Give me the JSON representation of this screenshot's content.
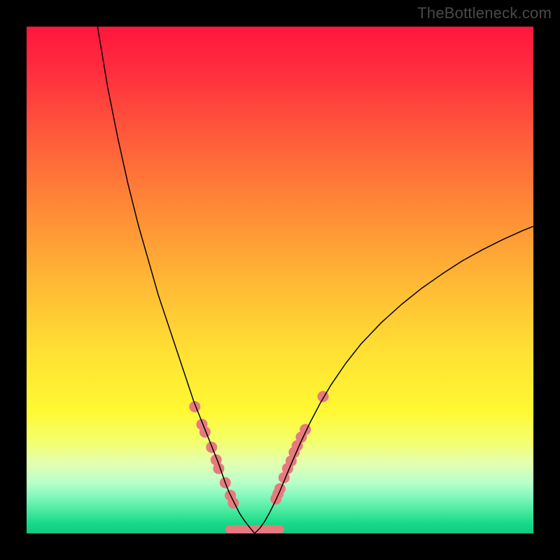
{
  "watermark": "TheBottleneck.com",
  "chart_data": {
    "type": "line",
    "title": "",
    "xlabel": "",
    "ylabel": "",
    "xlim": [
      0,
      100
    ],
    "ylim": [
      0,
      100
    ],
    "grid": false,
    "legend": false,
    "series": [
      {
        "name": "left-curve",
        "x": [
          14,
          16,
          18,
          20,
          22,
          24,
          26,
          28,
          30,
          32,
          33,
          34,
          35,
          36,
          37,
          37.8,
          38.5,
          39.2,
          40,
          41,
          42,
          43,
          44,
          45
        ],
        "y": [
          100,
          88,
          78,
          69,
          61,
          54,
          47,
          41,
          35,
          29,
          26,
          23.5,
          21,
          18.5,
          16,
          14,
          12,
          10,
          8,
          6,
          4,
          2.5,
          1.2,
          0
        ],
        "stroke": "#000000",
        "width": 1.5
      },
      {
        "name": "right-curve",
        "x": [
          45,
          46,
          47,
          48,
          49,
          50,
          51,
          52,
          54,
          56,
          58,
          60,
          63,
          66,
          70,
          74,
          78,
          82,
          86,
          90,
          94,
          98,
          100
        ],
        "y": [
          0,
          1,
          2.4,
          4.2,
          6.2,
          8.4,
          10.8,
          13.2,
          17.8,
          22,
          25.8,
          29.2,
          33.6,
          37.4,
          41.6,
          45.2,
          48.4,
          51.2,
          53.8,
          56,
          58,
          59.8,
          60.6
        ],
        "stroke": "#000000",
        "width": 1.5
      },
      {
        "name": "flat-bottom-segment",
        "x": [
          40,
          50
        ],
        "y": [
          0.8,
          0.8
        ],
        "stroke": "#e77a7e",
        "width": 12
      }
    ],
    "markers": {
      "name": "highlight-markers",
      "stroke": "none",
      "fill": "#e77a7e",
      "radius": 8,
      "points": [
        {
          "x": 33.2,
          "y": 25
        },
        {
          "x": 34.6,
          "y": 21.5
        },
        {
          "x": 35.2,
          "y": 20
        },
        {
          "x": 36.5,
          "y": 17
        },
        {
          "x": 37.4,
          "y": 14.5
        },
        {
          "x": 37.9,
          "y": 12.8
        },
        {
          "x": 39.2,
          "y": 10
        },
        {
          "x": 40.2,
          "y": 7.5
        },
        {
          "x": 40.8,
          "y": 6
        },
        {
          "x": 49.2,
          "y": 6.8
        },
        {
          "x": 49.6,
          "y": 7.8
        },
        {
          "x": 50.0,
          "y": 8.8
        },
        {
          "x": 50.8,
          "y": 11
        },
        {
          "x": 51.5,
          "y": 12.8
        },
        {
          "x": 52.2,
          "y": 14.3
        },
        {
          "x": 52.8,
          "y": 16
        },
        {
          "x": 53.4,
          "y": 17.3
        },
        {
          "x": 54.2,
          "y": 19
        },
        {
          "x": 55.0,
          "y": 20.5
        },
        {
          "x": 58.5,
          "y": 27
        }
      ]
    }
  }
}
